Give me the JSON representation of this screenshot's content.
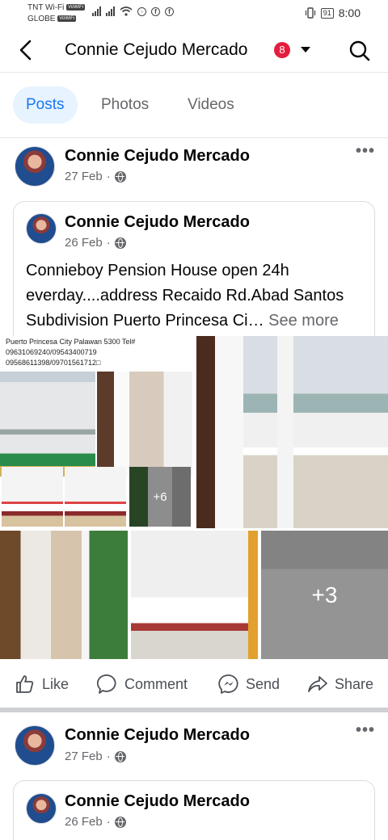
{
  "status_bar": {
    "carrier1": "TNT Wi-Fi",
    "carrier1_badge": "VoWiFi",
    "carrier2": "GLOBE",
    "carrier2_badge": "VoWiFi",
    "battery": "91",
    "time": "8:00"
  },
  "header": {
    "title": "Connie Cejudo Mercado",
    "notification_count": "8",
    "back_icon": "back-arrow-icon",
    "search_icon": "search-icon"
  },
  "tabs": [
    {
      "label": "Posts",
      "active": true
    },
    {
      "label": "Photos",
      "active": false
    },
    {
      "label": "Videos",
      "active": false
    }
  ],
  "post1": {
    "author": "Connie Cejudo Mercado",
    "date": "27 Feb",
    "separator": "·",
    "more": "•••",
    "shared": {
      "author": "Connie Cejudo Mercado",
      "date": "26 Feb",
      "separator": "·",
      "text": "Connieboy Pension House open 24h everday....address Recaido Rd.Abad Santos Subdivision Puerto Princesa Ci…",
      "see_more": "See more"
    },
    "photo_caption": [
      "Puerto Princesa City Palawan 5300 Tel#",
      "09631069240/09543400719",
      "09568611398/09701561712□"
    ],
    "overlay_small": "+6",
    "overlay_large": "+3"
  },
  "actions": {
    "like": "Like",
    "comment": "Comment",
    "send": "Send",
    "share": "Share"
  },
  "post2": {
    "author": "Connie Cejudo Mercado",
    "date": "27 Feb",
    "separator": "·",
    "more": "•••",
    "shared": {
      "author": "Connie Cejudo Mercado",
      "date": "26 Feb",
      "separator": "·"
    }
  },
  "colors": {
    "accent": "#1877f2",
    "badge": "#e41e3f",
    "muted": "#65676b"
  }
}
